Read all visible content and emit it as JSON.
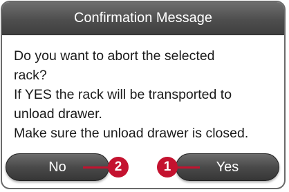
{
  "dialog": {
    "title": "Confirmation Message",
    "message_lines": [
      "Do you want to abort the selected",
      "rack?",
      "If YES the rack will be transported to",
      "unload drawer.",
      "Make sure the unload drawer is closed."
    ]
  },
  "buttons": {
    "no_label": "No",
    "yes_label": "Yes"
  },
  "callouts": {
    "no_number": "2",
    "yes_number": "1"
  },
  "colors": {
    "header": "#4e4e4e",
    "button": "#4a4a4a",
    "callout": "#c4122f"
  }
}
